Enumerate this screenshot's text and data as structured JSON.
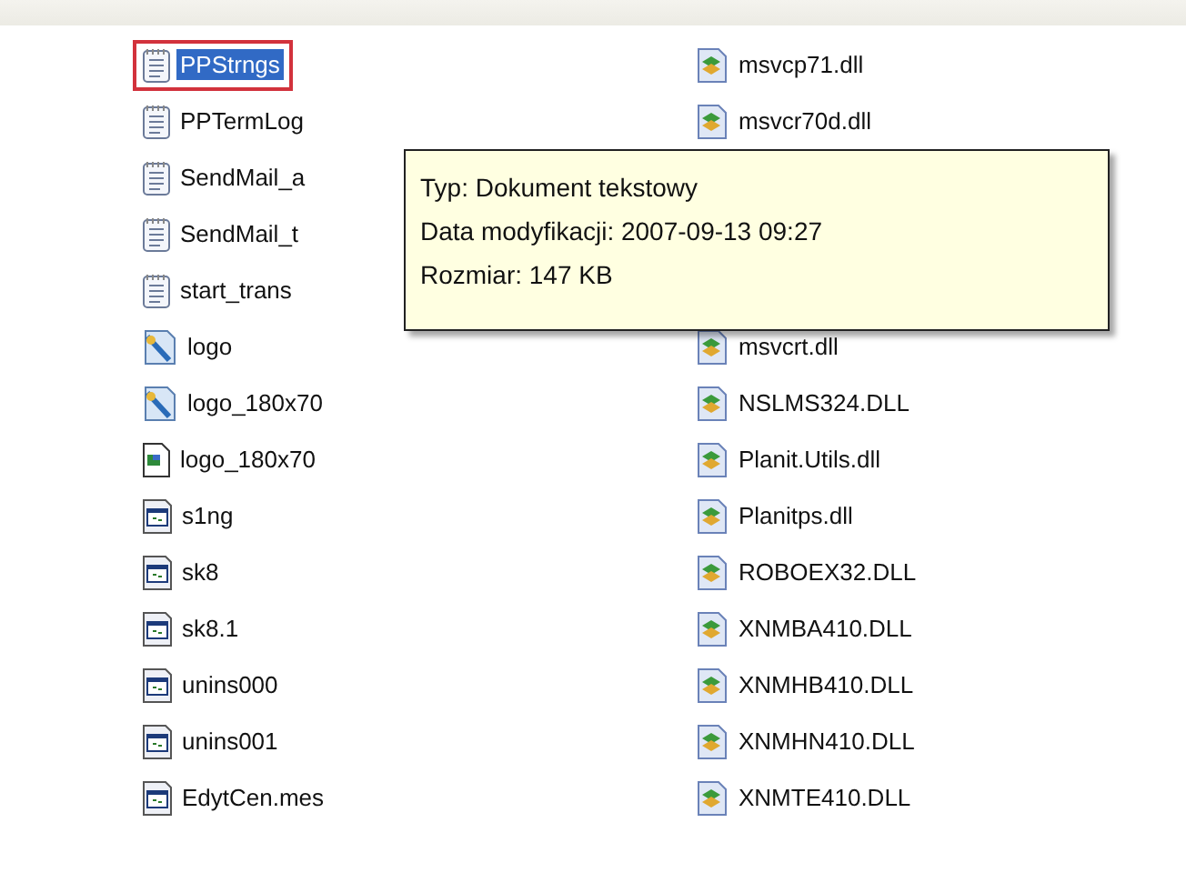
{
  "left_column": [
    {
      "name": "PPStrngs",
      "kind": "text",
      "selected": true,
      "outlined": true
    },
    {
      "name": "PPTermLog",
      "kind": "text",
      "selected": false,
      "outlined": false
    },
    {
      "name": "SendMail_a",
      "kind": "text",
      "selected": false,
      "outlined": false
    },
    {
      "name": "SendMail_t",
      "kind": "text",
      "selected": false,
      "outlined": false
    },
    {
      "name": "start_trans",
      "kind": "text",
      "selected": false,
      "outlined": false
    },
    {
      "name": "logo",
      "kind": "paint",
      "selected": false,
      "outlined": false
    },
    {
      "name": "logo_180x70",
      "kind": "paint",
      "selected": false,
      "outlined": false
    },
    {
      "name": "logo_180x70",
      "kind": "bitmap",
      "selected": false,
      "outlined": false
    },
    {
      "name": "s1ng",
      "kind": "app",
      "selected": false,
      "outlined": false
    },
    {
      "name": "sk8",
      "kind": "app",
      "selected": false,
      "outlined": false
    },
    {
      "name": "sk8.1",
      "kind": "app",
      "selected": false,
      "outlined": false
    },
    {
      "name": "unins000",
      "kind": "app",
      "selected": false,
      "outlined": false
    },
    {
      "name": "unins001",
      "kind": "app",
      "selected": false,
      "outlined": false
    },
    {
      "name": "EdytCen.mes",
      "kind": "app",
      "selected": false,
      "outlined": false
    }
  ],
  "right_column": {
    "items_above_tooltip": [
      {
        "name": "msvcp71.dll",
        "kind": "dll"
      },
      {
        "name": "msvcr70d.dll",
        "kind": "dll"
      }
    ],
    "items_below_tooltip": [
      {
        "name": "msvcrt.dll",
        "kind": "dll"
      },
      {
        "name": "NSLMS324.DLL",
        "kind": "dll"
      },
      {
        "name": "Planit.Utils.dll",
        "kind": "dll"
      },
      {
        "name": "Planitps.dll",
        "kind": "dll"
      },
      {
        "name": "ROBOEX32.DLL",
        "kind": "dll"
      },
      {
        "name": "XNMBA410.DLL",
        "kind": "dll"
      },
      {
        "name": "XNMHB410.DLL",
        "kind": "dll"
      },
      {
        "name": "XNMHN410.DLL",
        "kind": "dll"
      },
      {
        "name": "XNMTE410.DLL",
        "kind": "dll"
      }
    ]
  },
  "tooltip": {
    "lines": [
      "Typ: Dokument tekstowy",
      "Data modyfikacji: 2007-09-13 09:27",
      "Rozmiar: 147 KB"
    ]
  }
}
